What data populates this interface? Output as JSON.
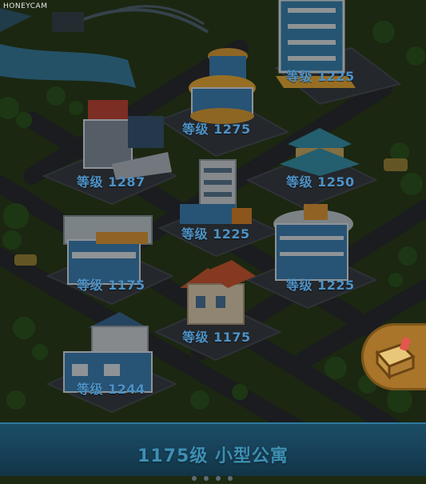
{
  "watermark": "HONEYCAM",
  "buildings": [
    {
      "level_text": "等级 1225"
    },
    {
      "level_text": "等级 1275"
    },
    {
      "level_text": "等级 1287"
    },
    {
      "level_text": "等级 1250"
    },
    {
      "level_text": "等级 1225"
    },
    {
      "level_text": "等级 1175"
    },
    {
      "level_text": "等级 1225"
    },
    {
      "level_text": "等级 1175"
    },
    {
      "level_text": "等级 1244"
    }
  ],
  "bottom_bar": {
    "title": "1175级 小型公寓",
    "page_dots": 4
  },
  "colors": {
    "level_text": "#4d92c6",
    "accent": "#2d7aa0",
    "side_button": "#a8752a"
  }
}
